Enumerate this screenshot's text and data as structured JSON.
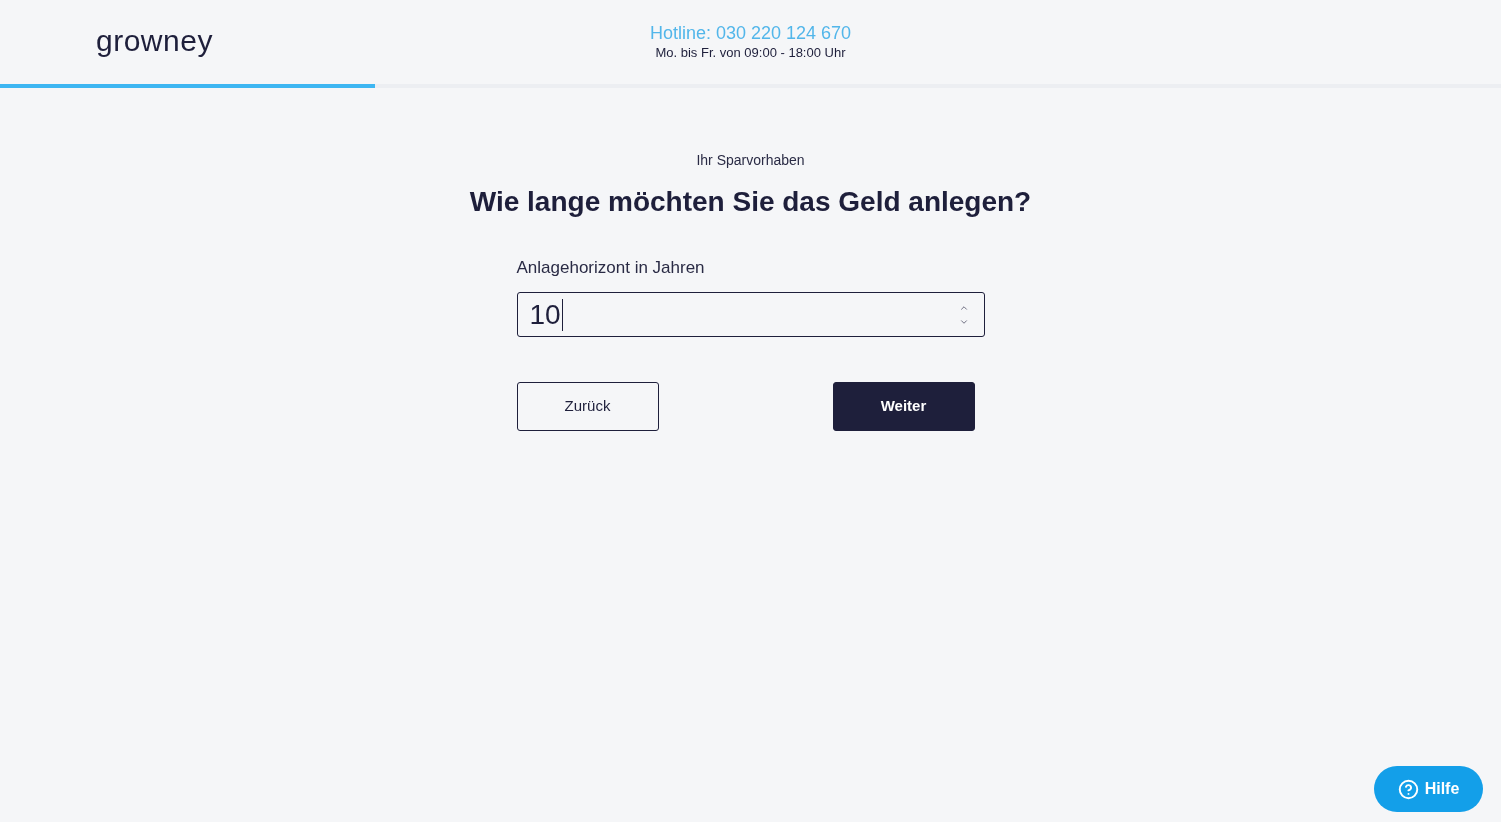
{
  "header": {
    "logo": "growney",
    "hotline": "Hotline: 030 220 124 670",
    "hours": "Mo. bis Fr. von 09:00 - 18:00 Uhr"
  },
  "progress": {
    "level": 0.25
  },
  "step": {
    "eyebrow": "Ihr Sparvorhaben",
    "question": "Wie lange möchten Sie das Geld anlegen?"
  },
  "field": {
    "label": "Anlagehorizont in Jahren",
    "value": "10"
  },
  "buttons": [
    {
      "label": "Zurück",
      "kind": "secondary"
    },
    {
      "label": "Weiter",
      "kind": "primary"
    }
  ],
  "help_button": {
    "label": "Hilfe"
  }
}
